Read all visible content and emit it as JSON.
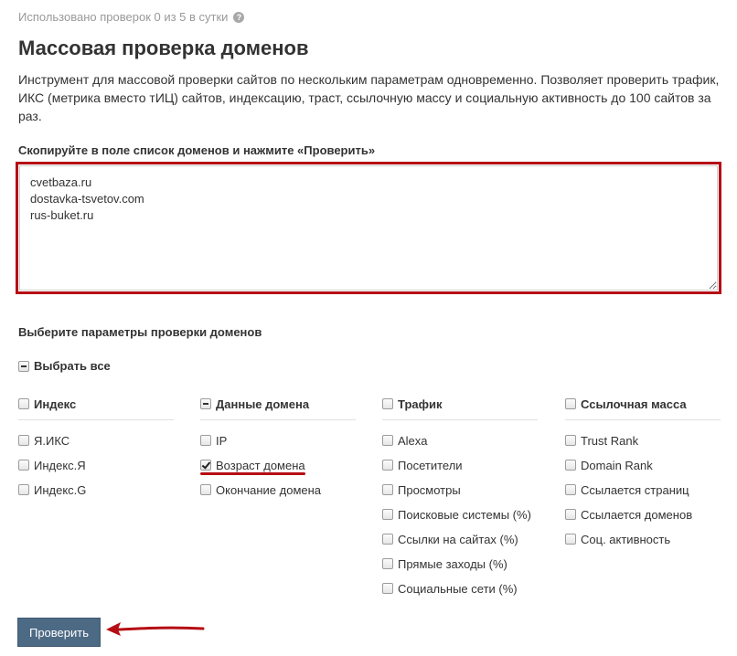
{
  "usage": {
    "text": "Использовано проверок 0 из 5 в сутки",
    "help_icon": "?"
  },
  "title": "Массовая проверка доменов",
  "description": "Инструмент для массовой проверки сайтов по нескольким параметрам одновременно. Позволяет проверить трафик, ИКС (метрика вместо тИЦ) сайтов, индексацию, траст, ссылочную массу и социальную активность до 100 сайтов за раз.",
  "domains": {
    "label": "Скопируйте в поле список доменов и нажмите «Проверить»",
    "value": "cvetbaza.ru\ndostavka-tsvetov.com\nrus-buket.ru"
  },
  "params_label": "Выберите параметры проверки доменов",
  "select_all": {
    "label": "Выбрать все",
    "state": "indeterminate"
  },
  "groups": [
    {
      "label": "Индекс",
      "state": "unchecked",
      "options": [
        {
          "label": "Я.ИКС",
          "checked": false
        },
        {
          "label": "Индекс.Я",
          "checked": false
        },
        {
          "label": "Индекс.G",
          "checked": false
        }
      ]
    },
    {
      "label": "Данные домена",
      "state": "indeterminate",
      "options": [
        {
          "label": "IP",
          "checked": false
        },
        {
          "label": "Возраст домена",
          "checked": true
        },
        {
          "label": "Окончание домена",
          "checked": false
        }
      ]
    },
    {
      "label": "Трафик",
      "state": "unchecked",
      "options": [
        {
          "label": "Alexa",
          "checked": false
        },
        {
          "label": "Посетители",
          "checked": false
        },
        {
          "label": "Просмотры",
          "checked": false
        },
        {
          "label": "Поисковые системы (%)",
          "checked": false
        },
        {
          "label": "Ссылки на сайтах (%)",
          "checked": false
        },
        {
          "label": "Прямые заходы (%)",
          "checked": false
        },
        {
          "label": "Социальные сети (%)",
          "checked": false
        }
      ]
    },
    {
      "label": "Ссылочная масса",
      "state": "unchecked",
      "options": [
        {
          "label": "Trust Rank",
          "checked": false
        },
        {
          "label": "Domain Rank",
          "checked": false
        },
        {
          "label": "Ссылается страниц",
          "checked": false
        },
        {
          "label": "Ссылается доменов",
          "checked": false
        },
        {
          "label": "Соц. активность",
          "checked": false
        }
      ]
    }
  ],
  "submit_label": "Проверить",
  "colors": {
    "highlight": "#b50d14",
    "button": "#4d6a85"
  }
}
